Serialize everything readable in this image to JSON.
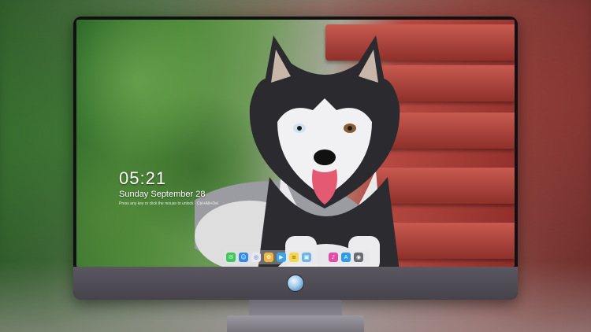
{
  "lock_screen": {
    "time": "05:21",
    "date": "Sunday September 28",
    "notice": "Press any key or click the mouse to unlock · Ctrl+Alt+Del"
  },
  "dock": {
    "left_apps": [
      {
        "icon": "messages-icon",
        "color": "#3cc95a"
      },
      {
        "icon": "finder-icon",
        "color": "#2f8be6"
      },
      {
        "icon": "safari-icon",
        "color": "#e8e8ee"
      },
      {
        "icon": "photos-icon",
        "color": "#f5b43a"
      },
      {
        "icon": "clapper-icon",
        "color": "#3aa6e8"
      },
      {
        "icon": "notes-icon",
        "color": "#f7d64a"
      },
      {
        "icon": "preview-icon",
        "color": "#6fb4e8"
      }
    ],
    "right_apps": [
      {
        "icon": "music-icon",
        "color": "#e64aa8"
      },
      {
        "icon": "app-store-icon",
        "color": "#2f9be8"
      },
      {
        "icon": "camera-icon",
        "color": "#6a6a72"
      }
    ]
  }
}
